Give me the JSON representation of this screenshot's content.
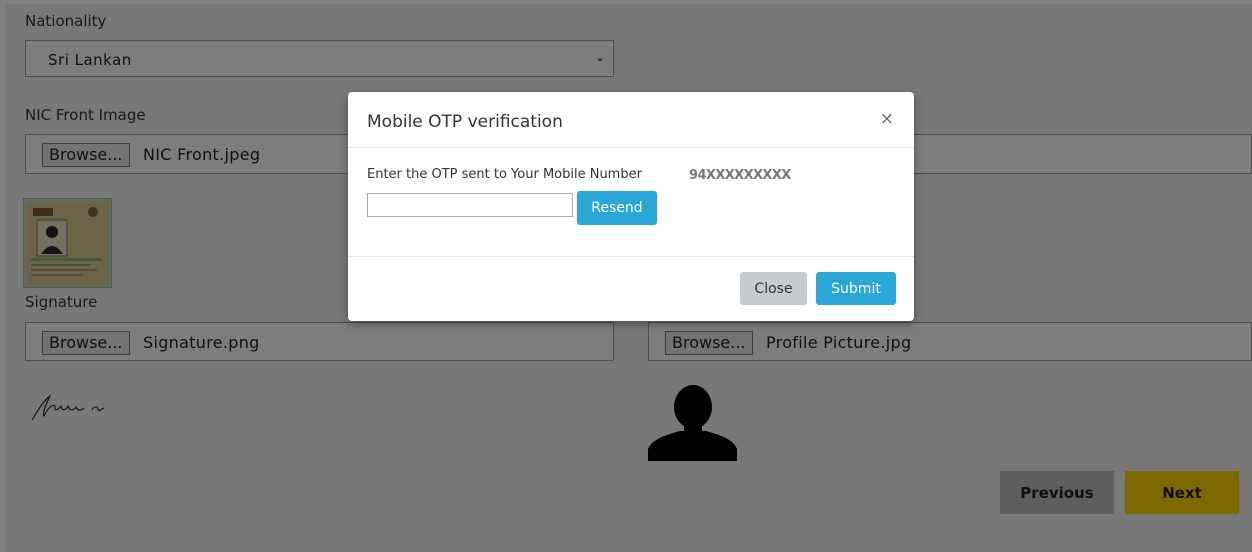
{
  "form": {
    "nationality_label": "Nationality",
    "nationality_value": "Sri Lankan",
    "nic_front_label": "NIC Front Image",
    "browse_label": "Browse...",
    "nic_front_file": "NIC Front.jpeg",
    "signature_label": "Signature",
    "signature_file": "Signature.png",
    "profile_file": "Profile Picture.jpg"
  },
  "nav": {
    "previous_label": "Previous",
    "next_label": "Next"
  },
  "modal": {
    "title": "Mobile OTP verification",
    "close_glyph": "×",
    "prompt": "Enter the OTP sent to Your Mobile Number",
    "mobile_number": "94XXXXXXXXX",
    "otp_value": "",
    "resend_label": "Resend",
    "close_label": "Close",
    "submit_label": "Submit"
  },
  "colors": {
    "primary_blue": "#2aa7d6",
    "next_yellow": "#fdd100",
    "previous_gray": "#bdbdbd",
    "overlay": "rgba(0,0,0,0.5)"
  },
  "icons": {
    "select_chevron": "chevron-down-icon",
    "nic_thumbnail": "nic-card-thumbnail",
    "signature": "signature-image",
    "profile": "person-silhouette-icon"
  }
}
